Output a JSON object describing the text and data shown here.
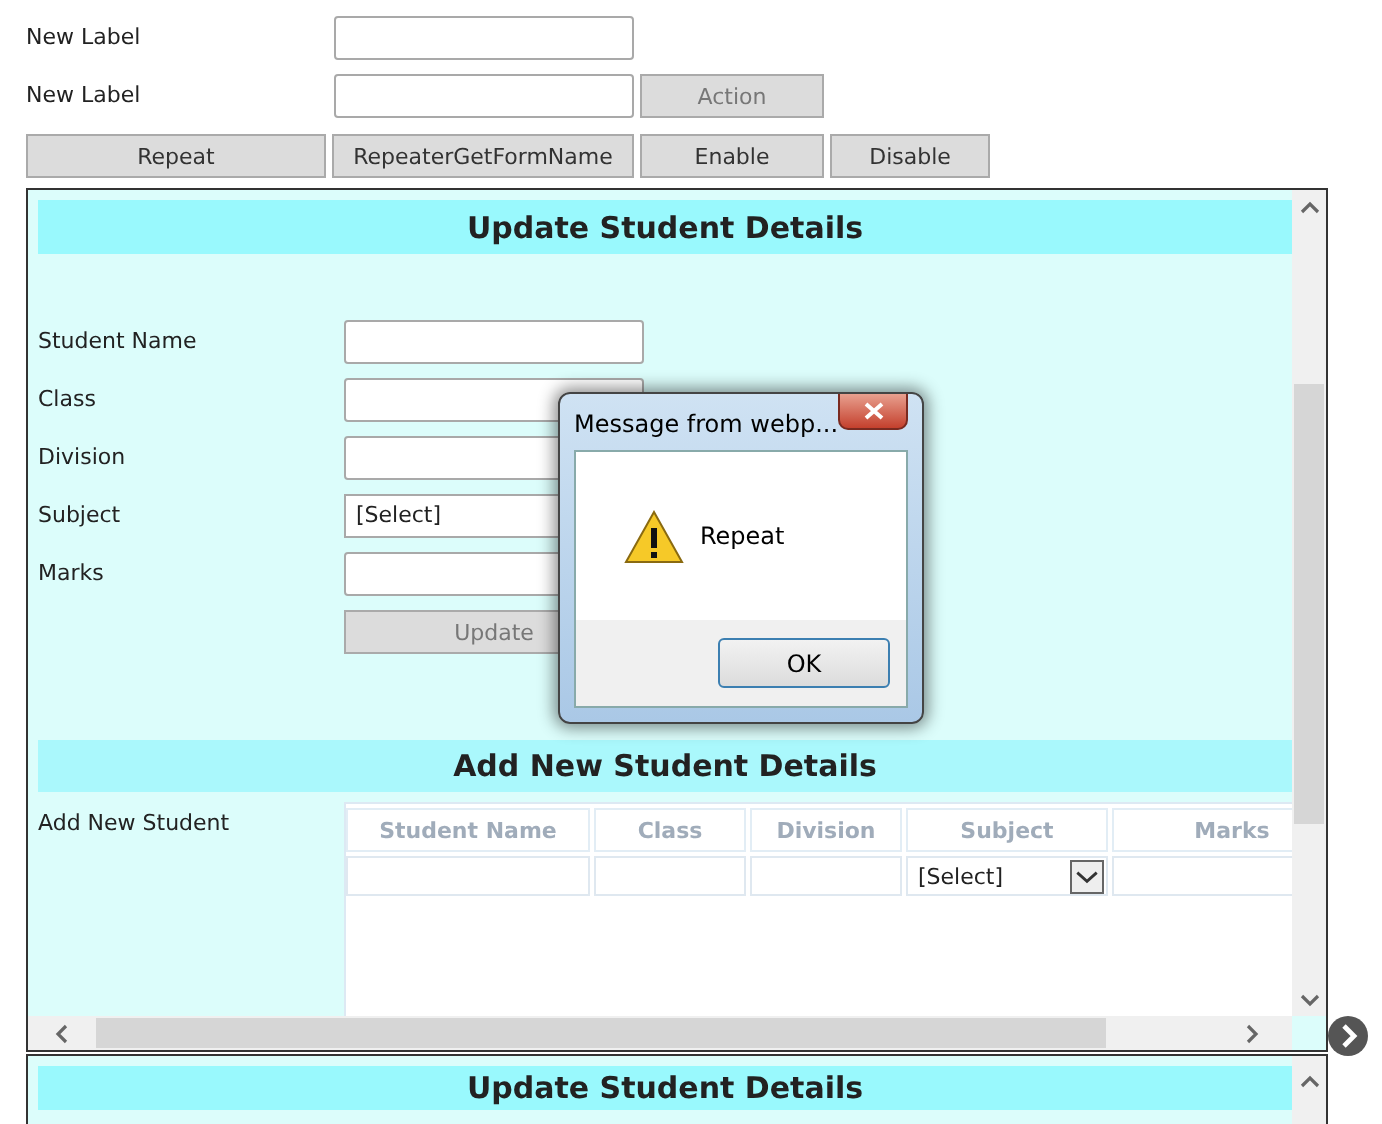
{
  "top_fields": [
    {
      "label": "New Label"
    },
    {
      "label": "New Label",
      "button": {
        "label": "Action",
        "disabled": true
      }
    }
  ],
  "toolbar": [
    "Repeat",
    "RepeaterGetFormName",
    "Enable",
    "Disable"
  ],
  "update_panel": {
    "title": "Update Student Details",
    "fields": [
      {
        "label": "Student Name",
        "kind": "text"
      },
      {
        "label": "Class",
        "kind": "text"
      },
      {
        "label": "Division",
        "kind": "text"
      },
      {
        "label": "Subject",
        "kind": "select",
        "value": "[Select]"
      },
      {
        "label": "Marks",
        "kind": "text"
      }
    ],
    "button": {
      "label": "Update",
      "disabled": true
    }
  },
  "add_panel": {
    "title": "Add New Student Details",
    "label": "Add New Student",
    "columns": [
      "Student Name",
      "Class",
      "Division",
      "Subject",
      "Marks"
    ],
    "row": [
      {
        "kind": "text"
      },
      {
        "kind": "text"
      },
      {
        "kind": "text"
      },
      {
        "kind": "select",
        "value": "[Select]"
      },
      {
        "kind": "text"
      }
    ]
  },
  "next_panel": {
    "title": "Update Student Details"
  },
  "dialog": {
    "title": "Message from webp...",
    "message": "Repeat",
    "button": "OK"
  }
}
